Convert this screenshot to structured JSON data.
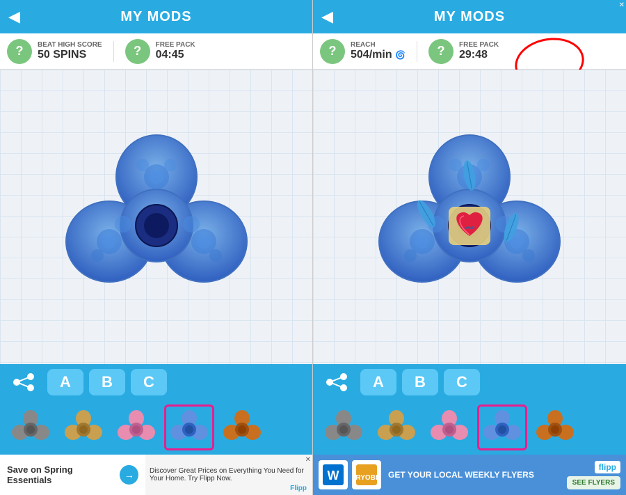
{
  "screens": [
    {
      "id": "screen-left",
      "header": {
        "title": "MY MODS",
        "back_label": "◀"
      },
      "stats": [
        {
          "icon": "?",
          "label": "BEAT HIGH SCORE",
          "value": "50 SPINS"
        },
        {
          "icon": "?",
          "label": "FREE PACK",
          "value": "04:45"
        }
      ],
      "tabs": [
        {
          "label": "share",
          "type": "share"
        },
        {
          "label": "A",
          "type": "letter"
        },
        {
          "label": "B",
          "type": "letter"
        },
        {
          "label": "C",
          "type": "letter"
        }
      ],
      "carousel": [
        {
          "color": "#7a7a7a",
          "selected": false
        },
        {
          "color": "#c8a050",
          "selected": false
        },
        {
          "color": "#e88cb0",
          "selected": false
        },
        {
          "color": "#6090e0",
          "selected": true
        },
        {
          "color": "#c87020",
          "selected": false
        }
      ],
      "ad": {
        "left_title": "Save on Spring Essentials",
        "right_text": "Discover Great Prices on Everything You Need for Your Home. Try Flipp Now.",
        "brand": "Flipp"
      }
    },
    {
      "id": "screen-right",
      "header": {
        "title": "MY MODS",
        "back_label": "◀"
      },
      "stats": [
        {
          "icon": "?",
          "label": "REACH",
          "value": "504/min"
        },
        {
          "icon": "?",
          "label": "FREE PACK",
          "value": "29:48"
        }
      ],
      "tabs": [
        {
          "label": "share",
          "type": "share"
        },
        {
          "label": "A",
          "type": "letter"
        },
        {
          "label": "B",
          "type": "letter"
        },
        {
          "label": "C",
          "type": "letter"
        }
      ],
      "carousel": [
        {
          "color": "#7a7a7a",
          "selected": false
        },
        {
          "color": "#c8a050",
          "selected": false
        },
        {
          "color": "#e88cb0",
          "selected": false
        },
        {
          "color": "#6090e0",
          "selected": true
        },
        {
          "color": "#c87020",
          "selected": false
        }
      ],
      "ad": {
        "left_title": "GET YOUR LOCAL WEEKLY FLYERS",
        "brand": "flipp",
        "see_flyers": "SEE FLYERS"
      }
    }
  ]
}
